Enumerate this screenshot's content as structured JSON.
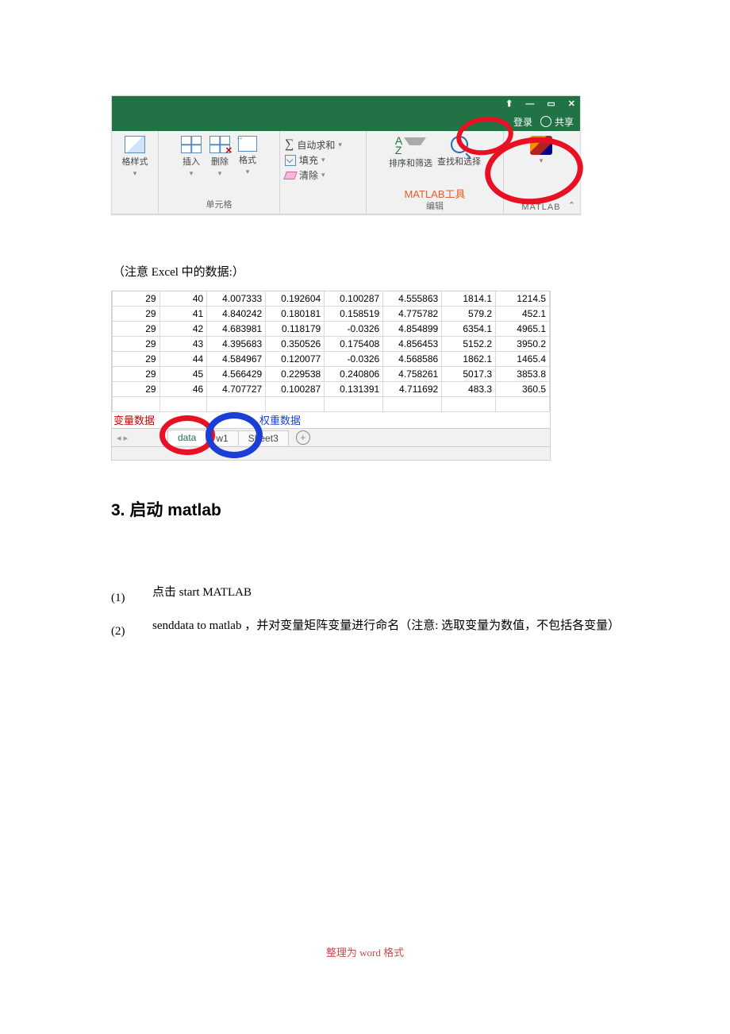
{
  "ribbon": {
    "window_controls": {
      "up": "⬆",
      "min": "—",
      "max": "▭",
      "close": "✕"
    },
    "signin": "登录",
    "share": "共享",
    "styles_label": "格样式",
    "insert_label": "插入",
    "delete_label": "删除",
    "format_label": "格式",
    "cells_group": "单元格",
    "autosum": "自动求和",
    "fill": "填充",
    "clear": "清除",
    "sort_filter": "排序和筛选",
    "find_select": "查找和选择",
    "matlab_tool": "MATLAB工具",
    "edit_group": "编辑",
    "matlab_group": "MATLAB",
    "collapse": "⌃"
  },
  "note": "（注意 Excel 中的数据:）",
  "data_table": {
    "rows": [
      [
        "29",
        "40",
        "4.007333",
        "0.192604",
        "0.100287",
        "4.555863",
        "1814.1",
        "1214.5"
      ],
      [
        "29",
        "41",
        "4.840242",
        "0.180181",
        "0.158519",
        "4.775782",
        "579.2",
        "452.1"
      ],
      [
        "29",
        "42",
        "4.683981",
        "0.118179",
        "-0.0326",
        "4.854899",
        "6354.1",
        "4965.1"
      ],
      [
        "29",
        "43",
        "4.395683",
        "0.350526",
        "0.175408",
        "4.856453",
        "5152.2",
        "3950.2"
      ],
      [
        "29",
        "44",
        "4.584967",
        "0.120077",
        "-0.0326",
        "4.568586",
        "1862.1",
        "1465.4"
      ],
      [
        "29",
        "45",
        "4.566429",
        "0.229538",
        "0.240806",
        "4.758261",
        "5017.3",
        "3853.8"
      ],
      [
        "29",
        "46",
        "4.707727",
        "0.100287",
        "0.131391",
        "4.711692",
        "483.3",
        "360.5"
      ]
    ]
  },
  "sheet_tabs": {
    "annot_var": "变量数据",
    "annot_weight": "权重数据",
    "t1": "data",
    "t2": "w1",
    "t3": "Sheet3"
  },
  "section_heading": "3. 启动 matlab",
  "list": {
    "n1": "(1)",
    "t1": "点击 start MATLAB",
    "n2": "(2)",
    "t2": "senddata to matlab ，并对变量矩阵变量进行命名（注意: 选取变量为数值，不包括各变量）"
  },
  "footer": "整理为 word 格式"
}
